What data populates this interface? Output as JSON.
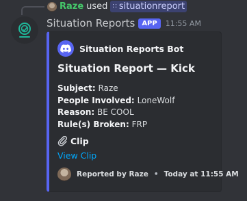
{
  "reply": {
    "user": "Raze",
    "used": "used",
    "command": "situationreport"
  },
  "message": {
    "username": "Situation Reports",
    "tag": "APP",
    "time": "11:55 AM"
  },
  "embed": {
    "accent_color": "#5865f2",
    "author": "Situation Reports Bot",
    "title": "Situation Report — Kick",
    "fields": [
      {
        "label": "Subject:",
        "value": "Raze"
      },
      {
        "label": "People Involved:",
        "value": "LoneWolf"
      },
      {
        "label": "Reason:",
        "value": "BE COOL"
      },
      {
        "label": "Rule(s) Broken:",
        "value": "FRP"
      }
    ],
    "clip_heading": "Clip",
    "clip_icon": "paperclip-icon",
    "clip_link": "View Clip",
    "footer": {
      "text": "Reported by Raze",
      "separator": "•",
      "time": "Today at 11:55 AM"
    }
  },
  "colors": {
    "background": "#313338",
    "embed_bg": "#2b2d31",
    "reply_user": "#45c76a",
    "link": "#00a8fc"
  }
}
